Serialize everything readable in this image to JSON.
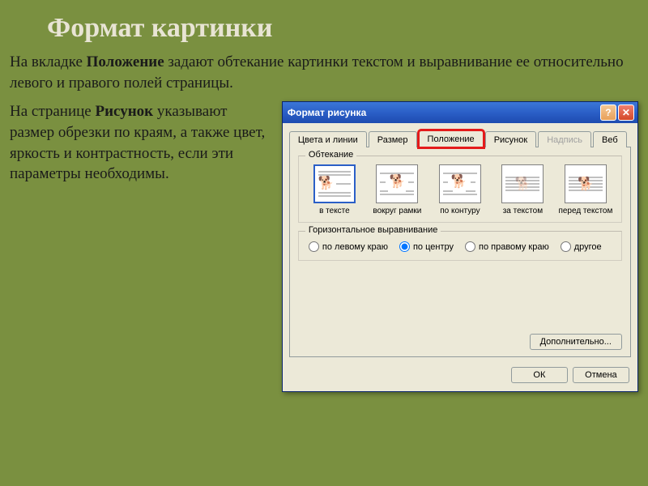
{
  "slide": {
    "title": "Формат картинки",
    "para1_pre": "На вкладке ",
    "para1_bold": "Положение",
    "para1_post": " задают обтекание картинки текстом и выравнивание ее относительно левого и правого полей страницы.",
    "para2_pre": "На странице ",
    "para2_bold": "Рисунок",
    "para2_post": " указывают размер обрезки по краям, а также цвет, яркость и контрастность, если эти параметры необходимы."
  },
  "dialog": {
    "title": "Формат рисунка",
    "help_icon": "?",
    "close_icon": "✕",
    "tabs": {
      "colors": "Цвета и линии",
      "size": "Размер",
      "position": "Положение",
      "picture": "Рисунок",
      "caption": "Надпись",
      "web": "Веб"
    },
    "wrap": {
      "group_label": "Обтекание",
      "options": {
        "inline": "в тексте",
        "square": "вокруг рамки",
        "tight": "по контуру",
        "behind": "за текстом",
        "front": "перед текстом"
      }
    },
    "align": {
      "group_label": "Горизонтальное выравнивание",
      "left": "по левому краю",
      "center": "по центру",
      "right": "по правому краю",
      "other": "другое"
    },
    "advanced_btn": "Дополнительно...",
    "ok_btn": "ОК",
    "cancel_btn": "Отмена"
  }
}
